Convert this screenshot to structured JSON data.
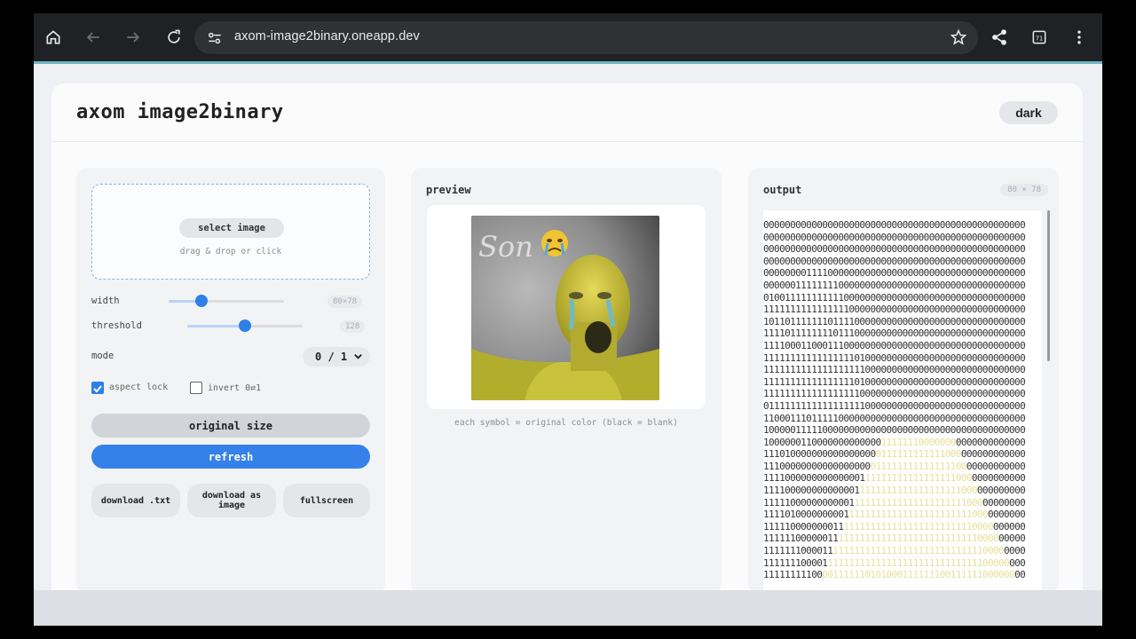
{
  "browser": {
    "url": "axom-image2binary.oneapp.dev",
    "tab_count": "71"
  },
  "app": {
    "title": "axom image2binary",
    "theme_toggle_label": "dark"
  },
  "upload": {
    "select_label": "select image",
    "hint": "drag & drop or click"
  },
  "controls": {
    "width_label": "width",
    "width_value": "80×78",
    "width_fraction": 0.26,
    "threshold_label": "threshold",
    "threshold_value": "128",
    "threshold_fraction": 0.5,
    "mode_label": "mode",
    "mode_value": "0 / 1",
    "aspect_lock_label": "aspect lock",
    "aspect_lock_checked": true,
    "invert_label": "invert 0⇄1",
    "invert_checked": false,
    "original_size_label": "original size",
    "refresh_label": "refresh",
    "download_txt_label": "download .txt",
    "download_image_label": "download as image",
    "fullscreen_label": "fullscreen"
  },
  "preview": {
    "heading": "preview",
    "image_overlay_text": "Son",
    "emoji": "😭",
    "caption": "each symbol = original color (black = blank)"
  },
  "output": {
    "heading": "output",
    "dims": "80 × 78",
    "lines": [
      "0000000000000000000000000000000000000000000000000",
      "0000000000000000000000000000000000000000000000000",
      "0000000000000000000000000000000000000000000000000",
      "0000000000000000000000000000000000000000000000000",
      "0000000011110000000000000000000000000000000000000",
      "0000001111111100000000000000000000000000000000000",
      "0100111111111110000000000000000000000000000000000",
      "1111111111111111000000000000000000000000000000000",
      "1011011111110111100000000000000000000000000000000",
      "1111011111111011100000000000000000000000000000000",
      "1111000110001110000000000000000000000000000000000",
      "1111111111111111101000000000000000000000000000000",
      "1111111111111111111000000000000000000000000000000",
      "1111111111111111101000000000000000000000000000000",
      "1111111111111111110000000000000000000000000000000",
      "0111111111111111111000000000000000000000000000000",
      "1100011101111100000000000000000000000000000000000",
      "1000001111100000000000000000000000000000000000000",
      "1000000110000000000000111111100000000000000000000",
      "1110100000000000000000111111111111000000000000000",
      "1110000000000000000001111111111111110000000000000",
      "1111000000000000001111111111111111110000000000000",
      "1111000000000000011111111111111111111000000000000",
      "1111100000000000111111111111111111111100000000000",
      "1111010000000001111111111111111111111110000000000",
      "1111100000000111111111111111111111111110000000000",
      "1111110000001111111111111111111111111111000000000",
      "1111111000011111111111111111111111111111100000000",
      "1111111000011111111111111111111111111111100000000",
      "1111111110000111111010100011111110011111100000000"
    ]
  }
}
